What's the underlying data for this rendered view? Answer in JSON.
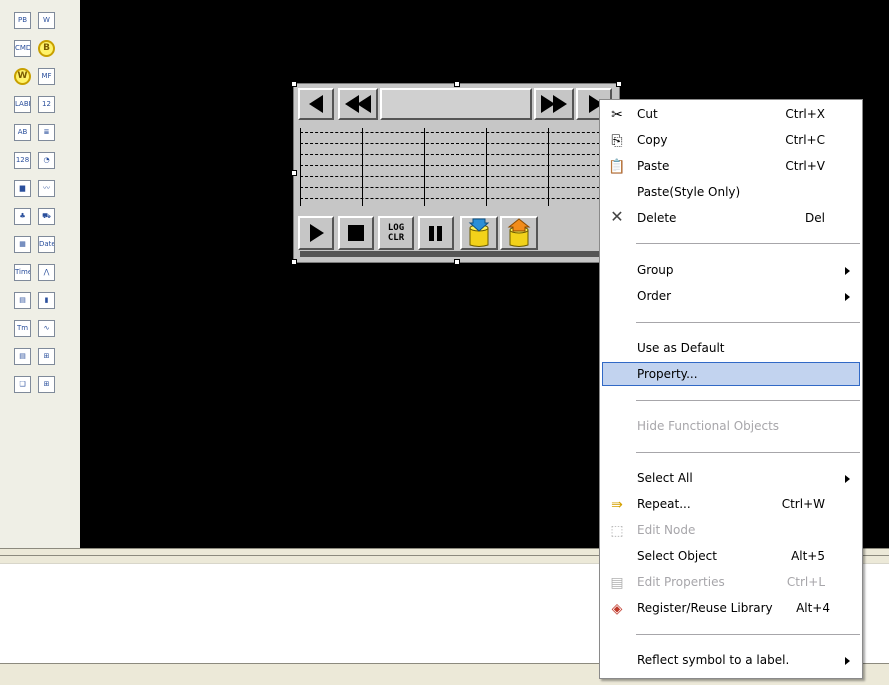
{
  "toolbox": {
    "items": [
      {
        "name": "pb-tool-icon",
        "text": "PB"
      },
      {
        "name": "w-tool-icon",
        "text": "W"
      },
      {
        "name": "cmd-tool-icon",
        "text": "CMD"
      },
      {
        "name": "b-lamp-icon",
        "text": "B"
      },
      {
        "name": "w-lamp-icon",
        "text": "W"
      },
      {
        "name": "mf-tool-icon",
        "text": "MF"
      },
      {
        "name": "label-tool-icon",
        "text": "LABEL"
      },
      {
        "name": "numeric-tool-icon",
        "text": "12"
      },
      {
        "name": "ascii-tool-icon",
        "text": "AB"
      },
      {
        "name": "list-tool-icon",
        "text": "≣"
      },
      {
        "name": "digit-tool-icon",
        "text": "128"
      },
      {
        "name": "meter-tool-icon",
        "text": "◔"
      },
      {
        "name": "bar-graph-icon",
        "text": "▆"
      },
      {
        "name": "trend-graph-icon",
        "text": "〰"
      },
      {
        "name": "picture-tool-icon",
        "text": "♣"
      },
      {
        "name": "parts-tool-icon",
        "text": "⛟"
      },
      {
        "name": "calendar-tool-icon",
        "text": "▦"
      },
      {
        "name": "date-tool-icon",
        "text": "Date"
      },
      {
        "name": "time-tool-icon",
        "text": "Time"
      },
      {
        "name": "line-chart-tool-icon",
        "text": "⋀"
      },
      {
        "name": "table-tool-icon",
        "text": "▤"
      },
      {
        "name": "slider-tool-icon",
        "text": "▮"
      },
      {
        "name": "text-input-tool-icon",
        "text": "Tm"
      },
      {
        "name": "waveform-tool-icon",
        "text": "∿"
      },
      {
        "name": "document-tool-icon",
        "text": "▤"
      },
      {
        "name": "recipe-tool-icon",
        "text": "⊞"
      },
      {
        "name": "window-tool-icon",
        "text": "❑"
      },
      {
        "name": "grid-tool-icon",
        "text": "⊞"
      }
    ]
  },
  "widget": {
    "log_clear_line1": "LOG",
    "log_clear_line2": "CLR"
  },
  "context_menu": {
    "cut": {
      "label": "Cut",
      "shortcut": "Ctrl+X"
    },
    "copy": {
      "label": "Copy",
      "shortcut": "Ctrl+C"
    },
    "paste": {
      "label": "Paste",
      "shortcut": "Ctrl+V"
    },
    "paste_style": {
      "label": "Paste(Style Only)"
    },
    "delete": {
      "label": "Delete",
      "shortcut": "Del"
    },
    "group": {
      "label": "Group"
    },
    "order": {
      "label": "Order"
    },
    "use_default": {
      "label": "Use as Default"
    },
    "property": {
      "label": "Property..."
    },
    "hide_functional": {
      "label": "Hide Functional Objects"
    },
    "select_all": {
      "label": "Select All"
    },
    "repeat": {
      "label": "Repeat...",
      "shortcut": "Ctrl+W"
    },
    "edit_node": {
      "label": "Edit Node"
    },
    "select_object": {
      "label": "Select Object",
      "shortcut": "Alt+5"
    },
    "edit_properties": {
      "label": "Edit Properties",
      "shortcut": "Ctrl+L"
    },
    "register_library": {
      "label": "Register/Reuse Library",
      "shortcut": "Alt+4"
    },
    "reflect_symbol": {
      "label": "Reflect symbol to a label."
    }
  }
}
